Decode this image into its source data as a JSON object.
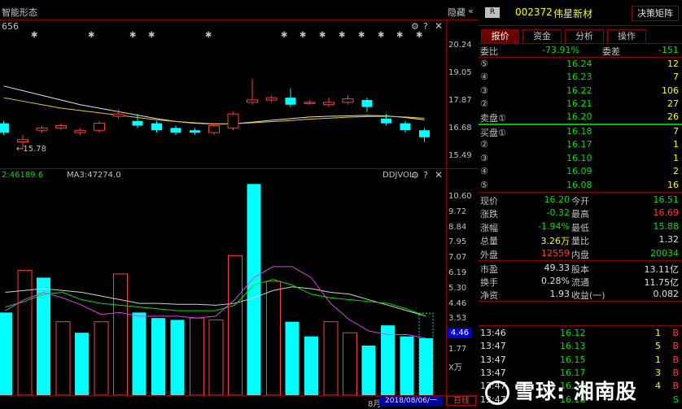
{
  "kline_panel": {
    "title": "智能形态",
    "hide_label": "隐藏",
    "left_value": "656",
    "price_axis": [
      "20.24",
      "19.05",
      "17.87",
      "16.68",
      "15.49"
    ],
    "low_marker": "←15.78",
    "candles": [
      {
        "o": 16.9,
        "c": 16.5,
        "h": 17.0,
        "l": 16.4
      },
      {
        "o": 16.1,
        "c": 16.2,
        "h": 16.4,
        "l": 15.78
      },
      {
        "o": 16.6,
        "c": 16.7,
        "h": 16.8,
        "l": 16.5
      },
      {
        "o": 16.7,
        "c": 16.8,
        "h": 16.9,
        "l": 16.6
      },
      {
        "o": 16.5,
        "c": 16.6,
        "h": 16.7,
        "l": 16.4
      },
      {
        "o": 16.6,
        "c": 16.9,
        "h": 17.0,
        "l": 16.5
      },
      {
        "o": 17.2,
        "c": 17.3,
        "h": 17.5,
        "l": 17.1
      },
      {
        "o": 17.0,
        "c": 16.8,
        "h": 17.3,
        "l": 16.7
      },
      {
        "o": 16.9,
        "c": 16.6,
        "h": 17.0,
        "l": 16.5
      },
      {
        "o": 16.7,
        "c": 16.5,
        "h": 16.8,
        "l": 16.4
      },
      {
        "o": 16.6,
        "c": 16.5,
        "h": 16.7,
        "l": 16.4
      },
      {
        "o": 16.5,
        "c": 16.8,
        "h": 16.9,
        "l": 16.4
      },
      {
        "o": 16.7,
        "c": 17.3,
        "h": 17.4,
        "l": 16.6
      },
      {
        "o": 17.8,
        "c": 17.9,
        "h": 18.8,
        "l": 17.7
      },
      {
        "o": 17.9,
        "c": 18.0,
        "h": 18.1,
        "l": 17.8
      },
      {
        "o": 18.0,
        "c": 17.7,
        "h": 18.4,
        "l": 17.6
      },
      {
        "o": 17.8,
        "c": 17.8,
        "h": 17.9,
        "l": 17.7
      },
      {
        "o": 17.7,
        "c": 17.8,
        "h": 18.0,
        "l": 17.6
      },
      {
        "o": 17.8,
        "c": 17.95,
        "h": 18.1,
        "l": 17.7
      },
      {
        "o": 17.9,
        "c": 17.6,
        "h": 18.0,
        "l": 17.4
      },
      {
        "o": 17.1,
        "c": 16.9,
        "h": 17.3,
        "l": 16.8
      },
      {
        "o": 16.9,
        "c": 16.6,
        "h": 17.0,
        "l": 16.5
      },
      {
        "o": 16.6,
        "c": 16.3,
        "h": 16.7,
        "l": 16.1
      }
    ],
    "ma1": [
      18.5,
      18.3,
      18.1,
      17.9,
      17.7,
      17.55,
      17.4,
      17.25,
      17.1,
      16.98,
      16.9,
      16.87,
      16.88,
      16.95,
      17.03,
      17.1,
      17.17,
      17.2,
      17.22,
      17.24,
      17.22,
      17.15,
      17.05
    ],
    "ma2": [
      18.0,
      17.85,
      17.7,
      17.55,
      17.45,
      17.35,
      17.25,
      17.15,
      17.05,
      16.98,
      16.92,
      16.88,
      16.88,
      16.92,
      16.97,
      17.02,
      17.08,
      17.12,
      17.16,
      17.19,
      17.2,
      17.17,
      17.12
    ]
  },
  "vol_panel": {
    "left_label": "2:46189.6",
    "ma3_label": "MA3:47274.0",
    "indicator": "DDJVOL",
    "axis": [
      "10.60",
      "9.72",
      "8.84",
      "7.95",
      "7.07",
      "6.19",
      "5.30",
      "4.46",
      "3.53",
      "2.65",
      "1.77",
      "X万"
    ],
    "current_value": "4.46",
    "bars": [
      {
        "v": 4.5,
        "up": false
      },
      {
        "v": 6.8,
        "up": true
      },
      {
        "v": 6.4,
        "up": false
      },
      {
        "v": 4.0,
        "up": true
      },
      {
        "v": 3.4,
        "up": false
      },
      {
        "v": 4.0,
        "up": true
      },
      {
        "v": 6.6,
        "up": true
      },
      {
        "v": 4.5,
        "up": false
      },
      {
        "v": 4.2,
        "up": false
      },
      {
        "v": 4.1,
        "up": false
      },
      {
        "v": 4.2,
        "up": true
      },
      {
        "v": 4.1,
        "up": true
      },
      {
        "v": 7.6,
        "up": true
      },
      {
        "v": 11.5,
        "up": false
      },
      {
        "v": 6.2,
        "up": true
      },
      {
        "v": 4.0,
        "up": false
      },
      {
        "v": 3.2,
        "up": false
      },
      {
        "v": 4.0,
        "up": true
      },
      {
        "v": 3.4,
        "up": true
      },
      {
        "v": 2.7,
        "up": false
      },
      {
        "v": 3.8,
        "up": false
      },
      {
        "v": 3.2,
        "up": false
      },
      {
        "v": 3.1,
        "up": false
      }
    ],
    "line_white": [
      5.6,
      5.7,
      5.8,
      5.7,
      5.6,
      5.4,
      5.2,
      5.0,
      5.0,
      4.95,
      4.95,
      4.9,
      5.0,
      5.3,
      5.7,
      5.9,
      5.8,
      5.6,
      5.5,
      5.2,
      4.9,
      4.6,
      4.3
    ],
    "line_green": [
      4.8,
      5.1,
      5.5,
      5.6,
      5.2,
      5.0,
      4.9,
      4.8,
      4.7,
      4.6,
      4.6,
      4.6,
      4.9,
      6.0,
      6.3,
      6.0,
      5.5,
      5.3,
      5.2,
      5.1,
      5.0,
      4.7,
      4.3
    ],
    "line_magenta": [
      4.6,
      5.2,
      5.6,
      5.3,
      4.9,
      4.4,
      4.5,
      4.3,
      4.3,
      4.3,
      4.2,
      4.3,
      5.2,
      6.4,
      7.0,
      7.0,
      6.4,
      5.0,
      4.1,
      3.5,
      3.3,
      3.3,
      3.1
    ]
  },
  "bottom_bar": {
    "month": "8月",
    "date": "2018/08/06/一",
    "timeframe": "日线"
  },
  "quote": {
    "badge": "R",
    "code": "002372",
    "name": "伟星新材",
    "matrix_button": "决策矩阵",
    "tabs": [
      "报价",
      "资金",
      "分析",
      "操作"
    ],
    "weibi_label": "委比",
    "weibi_value": "-73.91%",
    "weicha_label": "委差",
    "weicha_value": "-151",
    "asks": [
      {
        "label": "⑤",
        "price": "16.24",
        "vol": "12"
      },
      {
        "label": "④",
        "price": "16.23",
        "vol": "7"
      },
      {
        "label": "③",
        "price": "16.22",
        "vol": "106"
      },
      {
        "label": "②",
        "price": "16.21",
        "vol": "27"
      },
      {
        "label": "卖盘①",
        "price": "16.20",
        "vol": "26"
      }
    ],
    "bids": [
      {
        "label": "买盘①",
        "price": "16.18",
        "vol": "7"
      },
      {
        "label": "②",
        "price": "16.17",
        "vol": "1"
      },
      {
        "label": "③",
        "price": "16.10",
        "vol": "1"
      },
      {
        "label": "④",
        "price": "16.09",
        "vol": "2"
      },
      {
        "label": "⑤",
        "price": "16.08",
        "vol": "16"
      }
    ],
    "stats": [
      {
        "l1": "现价",
        "v1": "16.20",
        "c1": "grn",
        "l2": "今开",
        "v2": "16.51",
        "c2": "grn"
      },
      {
        "l1": "涨跌",
        "v1": "-0.32",
        "c1": "grn",
        "l2": "最高",
        "v2": "16.69",
        "c2": "red"
      },
      {
        "l1": "涨幅",
        "v1": "-1.94%",
        "c1": "grn",
        "l2": "最低",
        "v2": "15.88",
        "c2": "grn"
      },
      {
        "l1": "总量",
        "v1": "3.26万",
        "c1": "yel",
        "l2": "量比",
        "v2": "1.32",
        "c2": "wht"
      },
      {
        "l1": "外盘",
        "v1": "12559",
        "c1": "red",
        "l2": "内盘",
        "v2": "20034",
        "c2": "grn"
      }
    ],
    "fund": [
      {
        "l1": "市盈",
        "v1": "49.33",
        "l2": "股本",
        "v2": "13.11亿"
      },
      {
        "l1": "换手",
        "v1": "0.28%",
        "l2": "流通",
        "v2": "11.75亿"
      },
      {
        "l1": "净资",
        "v1": "1.93",
        "l2": "收益(一)",
        "v2": "0.082"
      }
    ],
    "ticks": [
      {
        "t": "13:46",
        "p": "16.12",
        "v": "1",
        "s": "B"
      },
      {
        "t": "13:47",
        "p": "16.13",
        "v": "5",
        "s": "B"
      },
      {
        "t": "13:47",
        "p": "16.15",
        "v": "1",
        "s": "B"
      },
      {
        "t": "13:47",
        "p": "16.17",
        "v": "3",
        "s": "B"
      },
      {
        "t": "13:47",
        "p": "16.20",
        "v": "4",
        "s": "B"
      },
      {
        "t": "13:47",
        "p": "16.18",
        "v": "",
        "s": "S"
      }
    ]
  },
  "watermark": "雪球: 湘南股",
  "colors": {
    "up": "#ff3c3c",
    "down": "#00ffff",
    "grid": "#8b0000",
    "ma1": "#e0e0e0",
    "ma2": "#e8c800"
  }
}
